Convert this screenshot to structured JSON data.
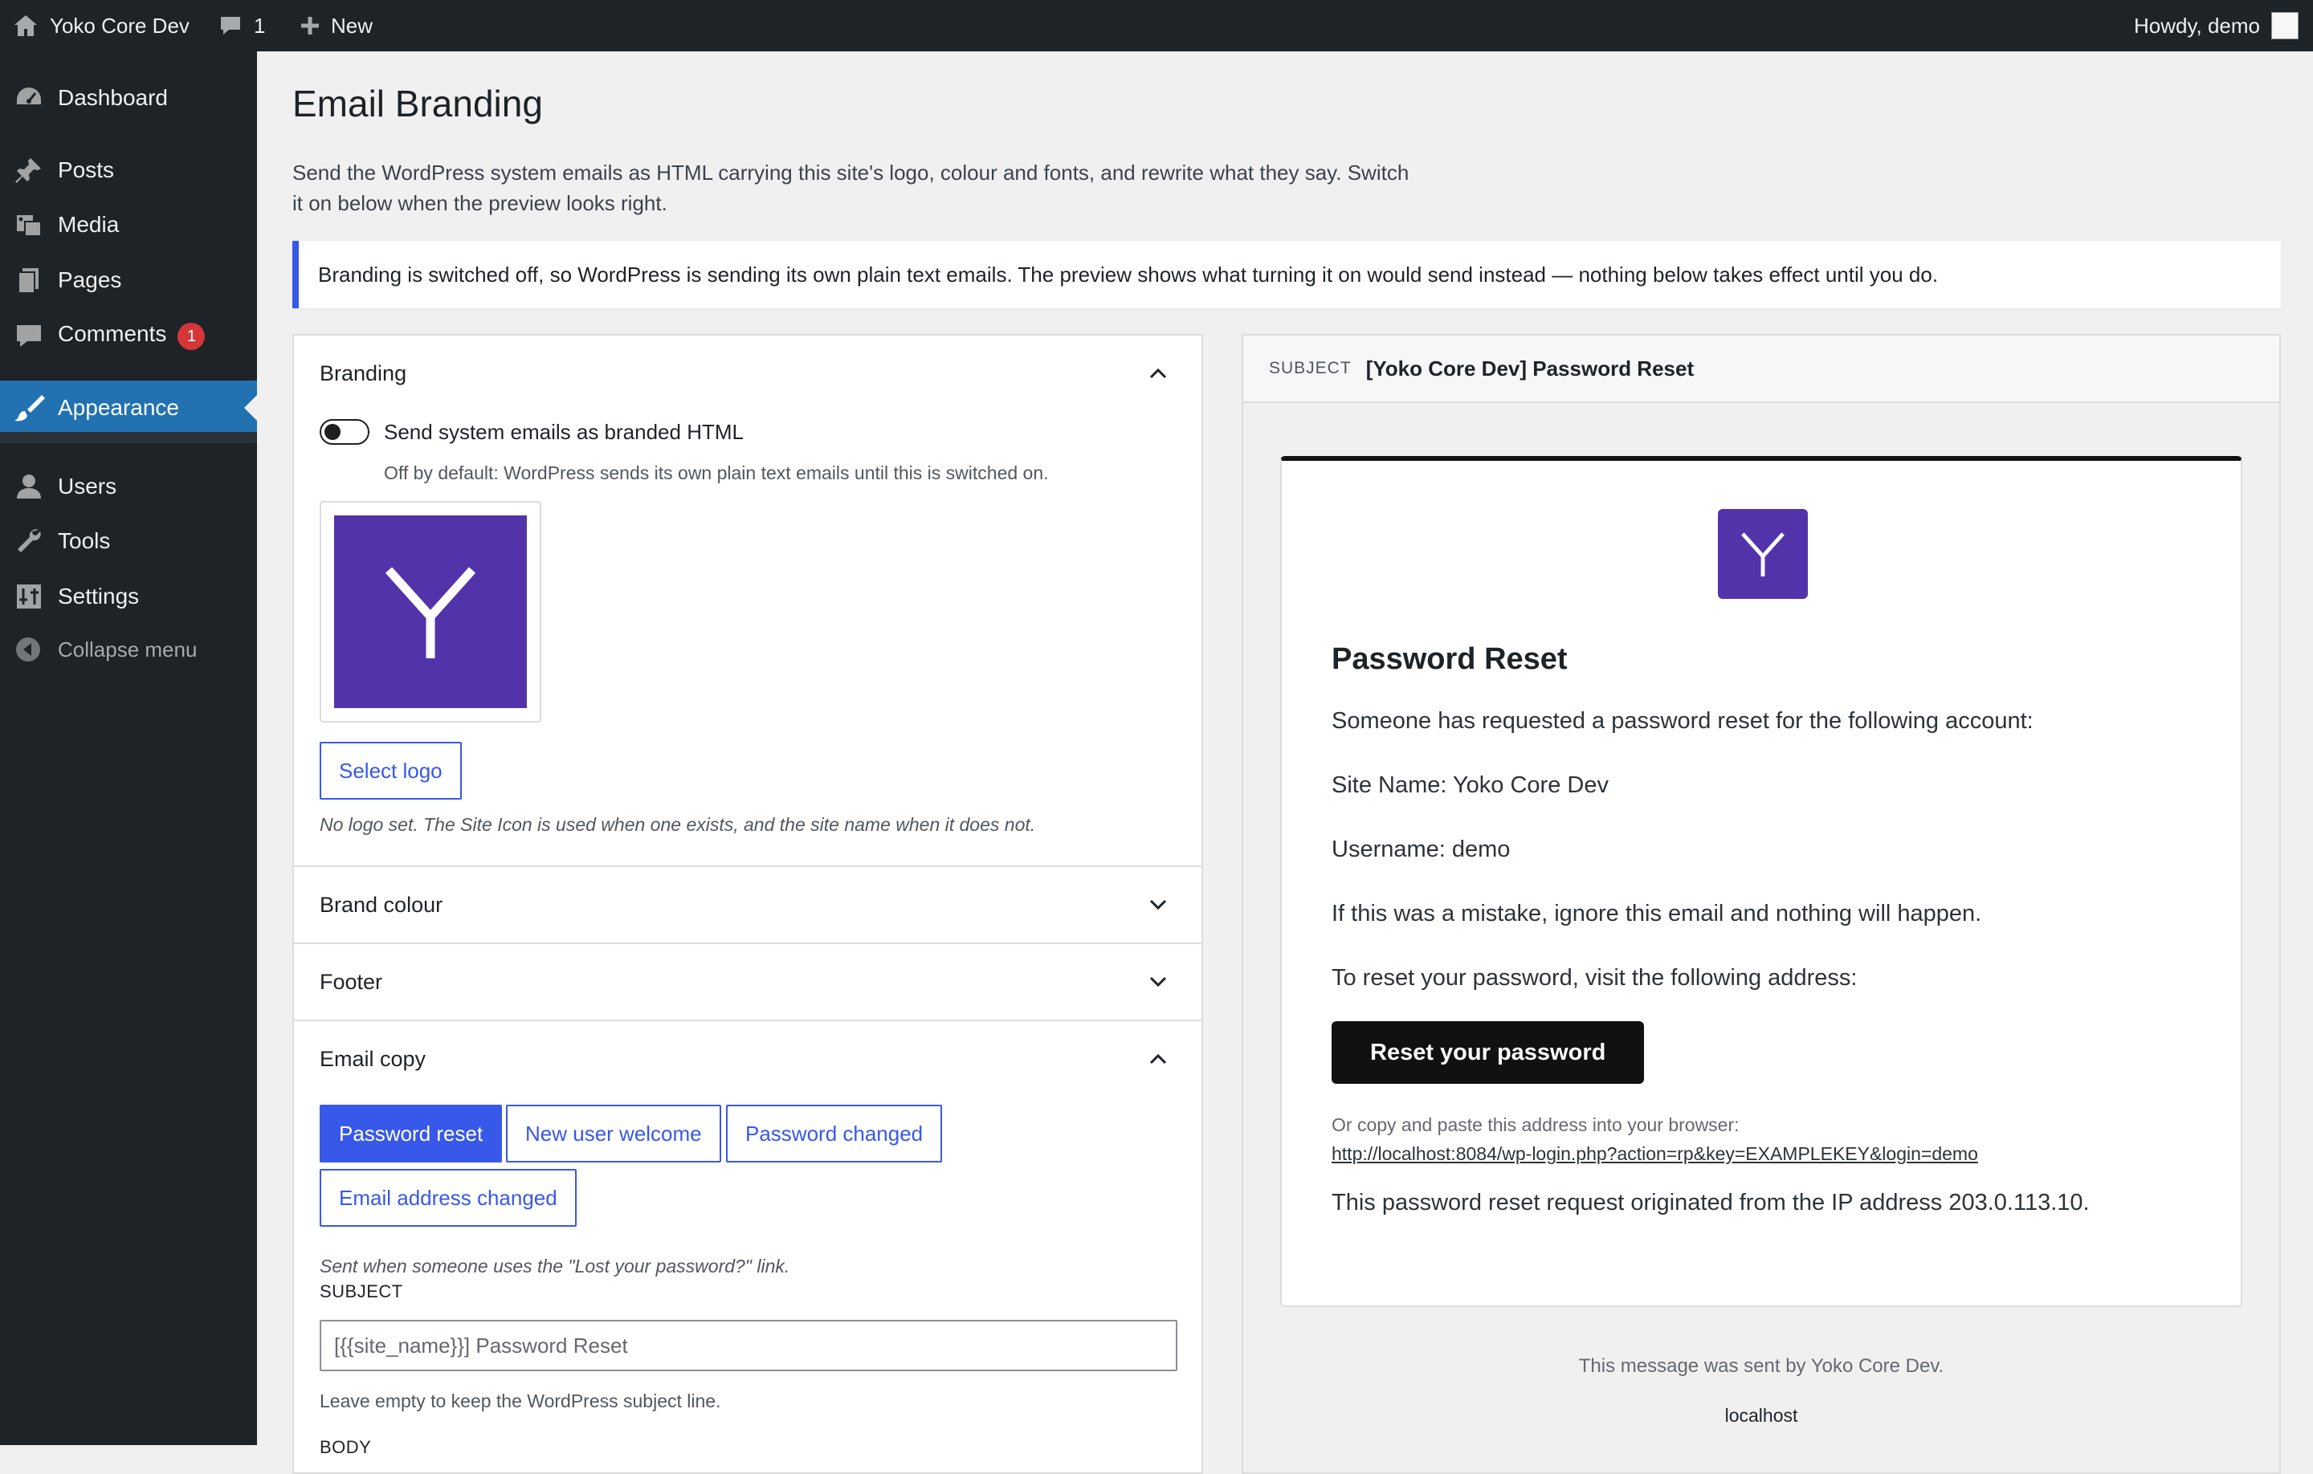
{
  "adminbar": {
    "site_name": "Yoko Core Dev",
    "comments_count": "1",
    "new_label": "New",
    "howdy": "Howdy, demo"
  },
  "sidebar": {
    "items": [
      {
        "label": "Dashboard",
        "icon": "dashboard-icon"
      },
      {
        "label": "Posts",
        "icon": "pushpin-icon"
      },
      {
        "label": "Media",
        "icon": "media-icon"
      },
      {
        "label": "Pages",
        "icon": "pages-icon"
      },
      {
        "label": "Comments",
        "icon": "comment-icon",
        "badge": "1"
      },
      {
        "label": "Appearance",
        "icon": "paintbrush-icon",
        "current": true
      },
      {
        "label": "Users",
        "icon": "users-icon"
      },
      {
        "label": "Tools",
        "icon": "wrench-icon"
      },
      {
        "label": "Settings",
        "icon": "settings-icon"
      }
    ],
    "collapse_label": "Collapse menu"
  },
  "page": {
    "title": "Email Branding",
    "intro": "Send the WordPress system emails as HTML carrying this site's logo, colour and fonts, and rewrite what they say. Switch it on below when the preview looks right.",
    "notice": "Branding is switched off, so WordPress is sending its own plain text emails. The preview shows what turning it on would send instead — nothing below takes effect until you do."
  },
  "settings": {
    "branding": {
      "title": "Branding",
      "expanded": true,
      "toggle_label": "Send system emails as branded HTML",
      "toggle_on": false,
      "toggle_help": "Off by default: WordPress sends its own plain text emails until this is switched on.",
      "logo_letter": "Y",
      "select_logo_label": "Select logo",
      "logo_help": "No logo set. The Site Icon is used when one exists, and the site name when it does not."
    },
    "brand_colour": {
      "title": "Brand colour",
      "expanded": false
    },
    "footer": {
      "title": "Footer",
      "expanded": false
    },
    "email_copy": {
      "title": "Email copy",
      "expanded": true,
      "tabs": [
        "Password reset",
        "New user welcome",
        "Password changed",
        "Email address changed"
      ],
      "active_tab": "Password reset",
      "tab_help": "Sent when someone uses the \"Lost your password?\" link.",
      "subject_label": "SUBJECT",
      "subject_value": "",
      "subject_placeholder": "[{{site_name}}] Password Reset",
      "subject_help": "Leave empty to keep the WordPress subject line.",
      "body_label": "BODY"
    }
  },
  "preview": {
    "subject_key": "SUBJECT",
    "subject_value": "[Yoko Core Dev] Password Reset",
    "email": {
      "logo_letter": "Y",
      "heading": "Password Reset",
      "paragraphs": [
        "Someone has requested a password reset for the following account:",
        "Site Name: Yoko Core Dev",
        "Username: demo",
        "If this was a mistake, ignore this email and nothing will happen.",
        "To reset your password, visit the following address:"
      ],
      "cta_label": "Reset your password",
      "copy_hint": "Or copy and paste this address into your browser:",
      "link": "http://localhost:8084/wp-login.php?action=rp&key=EXAMPLEKEY&login=demo",
      "ip_line": "This password reset request originated from the IP address 203.0.113.10."
    },
    "footer_text": "This message was sent by Yoko Core Dev.",
    "footer_host": "localhost"
  },
  "colors": {
    "wp_blue": "#2271b1",
    "accent": "#3858e9",
    "logo_purple": "#5333aa",
    "admin_dark": "#1d2327",
    "badge_red": "#d63638"
  }
}
